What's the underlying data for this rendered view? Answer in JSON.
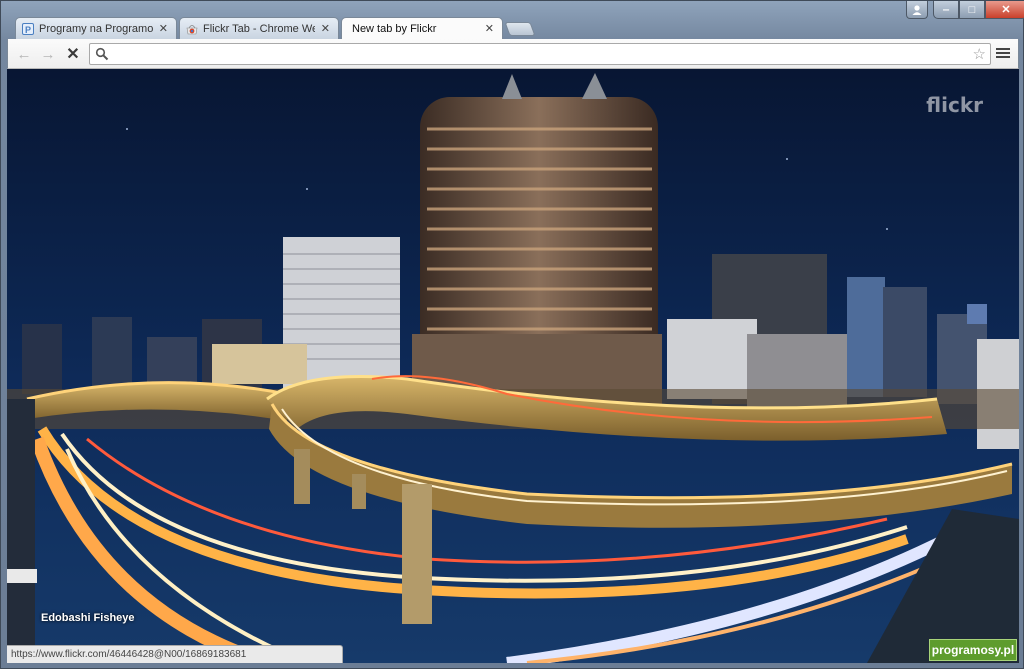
{
  "browser": {
    "tabs": [
      {
        "title": "Programy na Programosy",
        "favicon": "programosy-icon",
        "favicon_color": "#4a7fc1",
        "active": false
      },
      {
        "title": "Flickr Tab - Chrome Web S",
        "favicon": "chrome-web-store-icon",
        "favicon_color": "#d9472b",
        "active": false
      },
      {
        "title": "New tab by Flickr",
        "favicon": "",
        "favicon_color": "",
        "active": true
      }
    ],
    "tab_close_glyph": "✕",
    "omnibox": {
      "value": "",
      "placeholder": ""
    },
    "window_controls": {
      "minimize": "‒",
      "maximize": "□",
      "close": "✕"
    }
  },
  "page": {
    "brand": "flickr",
    "photo_title": "Edobashi Fisheye",
    "status_url": "https://www.flickr.com/46446428@N00/16869183681",
    "watermark": "programosy.pl"
  },
  "colors": {
    "sky": "#0b1d3f",
    "light_trail": "#ffb347",
    "highway": "#b59a5c",
    "watermark_bg": "#5e9c2d"
  }
}
